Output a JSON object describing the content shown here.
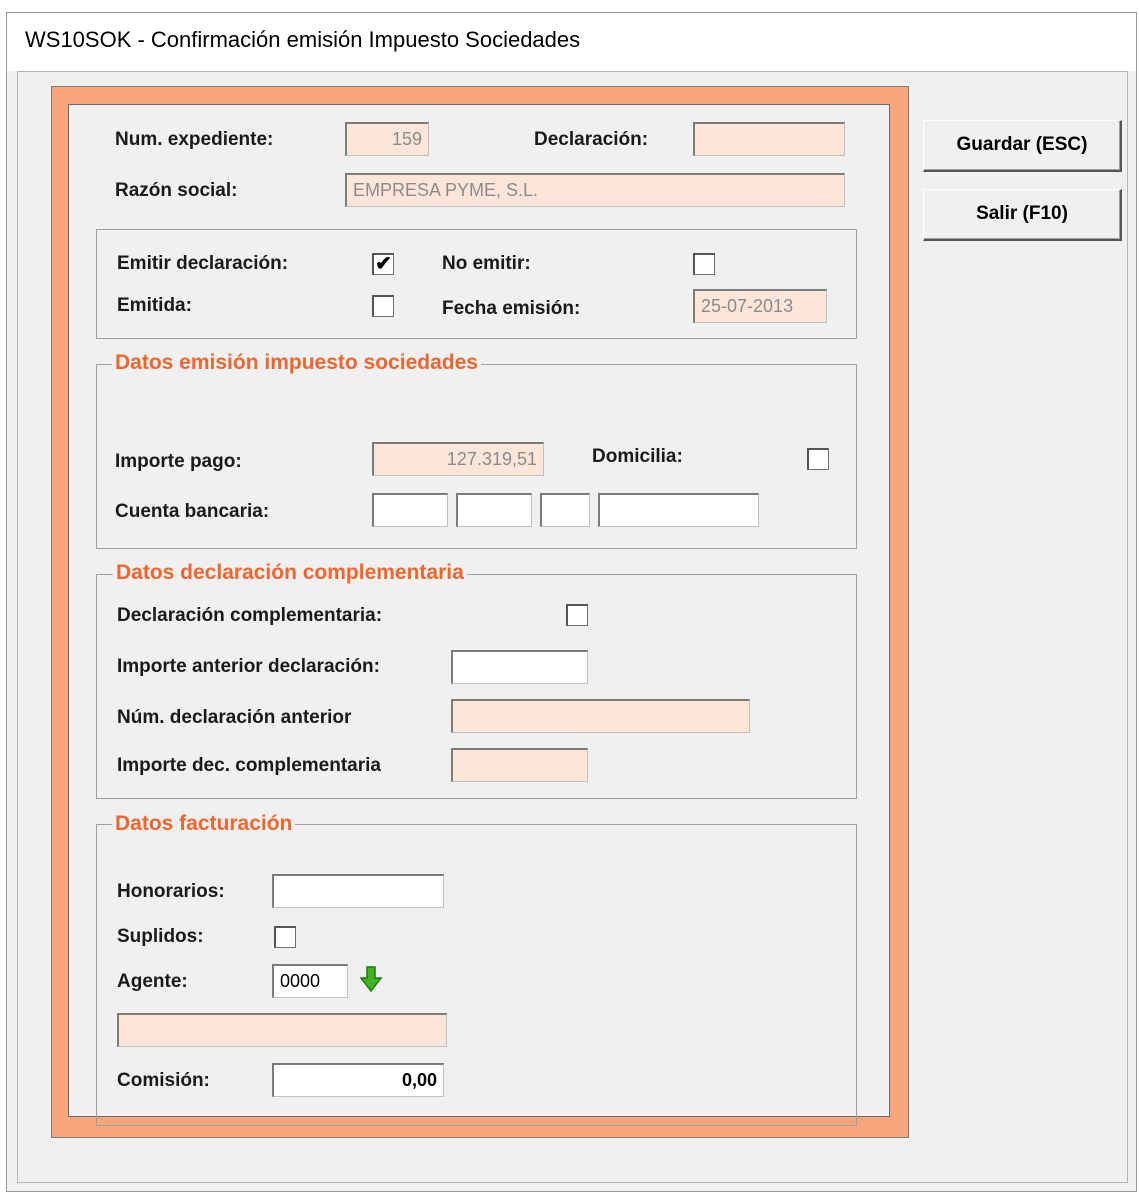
{
  "window": {
    "title": "WS10SOK - Confirmación emisión Impuesto Sociedades"
  },
  "buttons": {
    "guardar": "Guardar (ESC)",
    "salir": "Salir (F10)"
  },
  "header": {
    "num_expediente_label": "Num. expediente:",
    "num_expediente_value": "159",
    "declaracion_label": "Declaración:",
    "declaracion_value": "",
    "razon_social_label": "Razón social:",
    "razon_social_value": "EMPRESA PYME, S.L."
  },
  "emision": {
    "emitir_label": "Emitir declaración:",
    "emitir_checked": true,
    "emitir_mark": "✔",
    "no_emitir_label": "No emitir:",
    "emitida_label": "Emitida:",
    "fecha_label": "Fecha emisión:",
    "fecha_value": "25-07-2013"
  },
  "impuesto": {
    "legend": "Datos emisión impuesto sociedades",
    "importe_label": "Importe pago:",
    "importe_value": "127.319,51",
    "domicilia_label": "Domicilia:",
    "cuenta_label": "Cuenta bancaria:"
  },
  "complementaria": {
    "legend": "Datos declaración complementaria",
    "declaracion_label": "Declaración complementaria:",
    "importe_anterior_label": "Importe anterior declaración:",
    "num_anterior_label": "Núm. declaración anterior",
    "importe_dec_label": "Importe dec. complementaria"
  },
  "facturacion": {
    "legend": "Datos facturación",
    "honorarios_label": "Honorarios:",
    "suplidos_label": "Suplidos:",
    "agente_label": "Agente:",
    "agente_value": "0000",
    "agente_icon": "green-down-arrow-icon",
    "comision_label": "Comisión:",
    "comision_value": "0,00"
  },
  "colors": {
    "frame_orange": "#f9a67c",
    "legend_orange": "#f2652c",
    "readonly_field": "#fde6d9"
  }
}
